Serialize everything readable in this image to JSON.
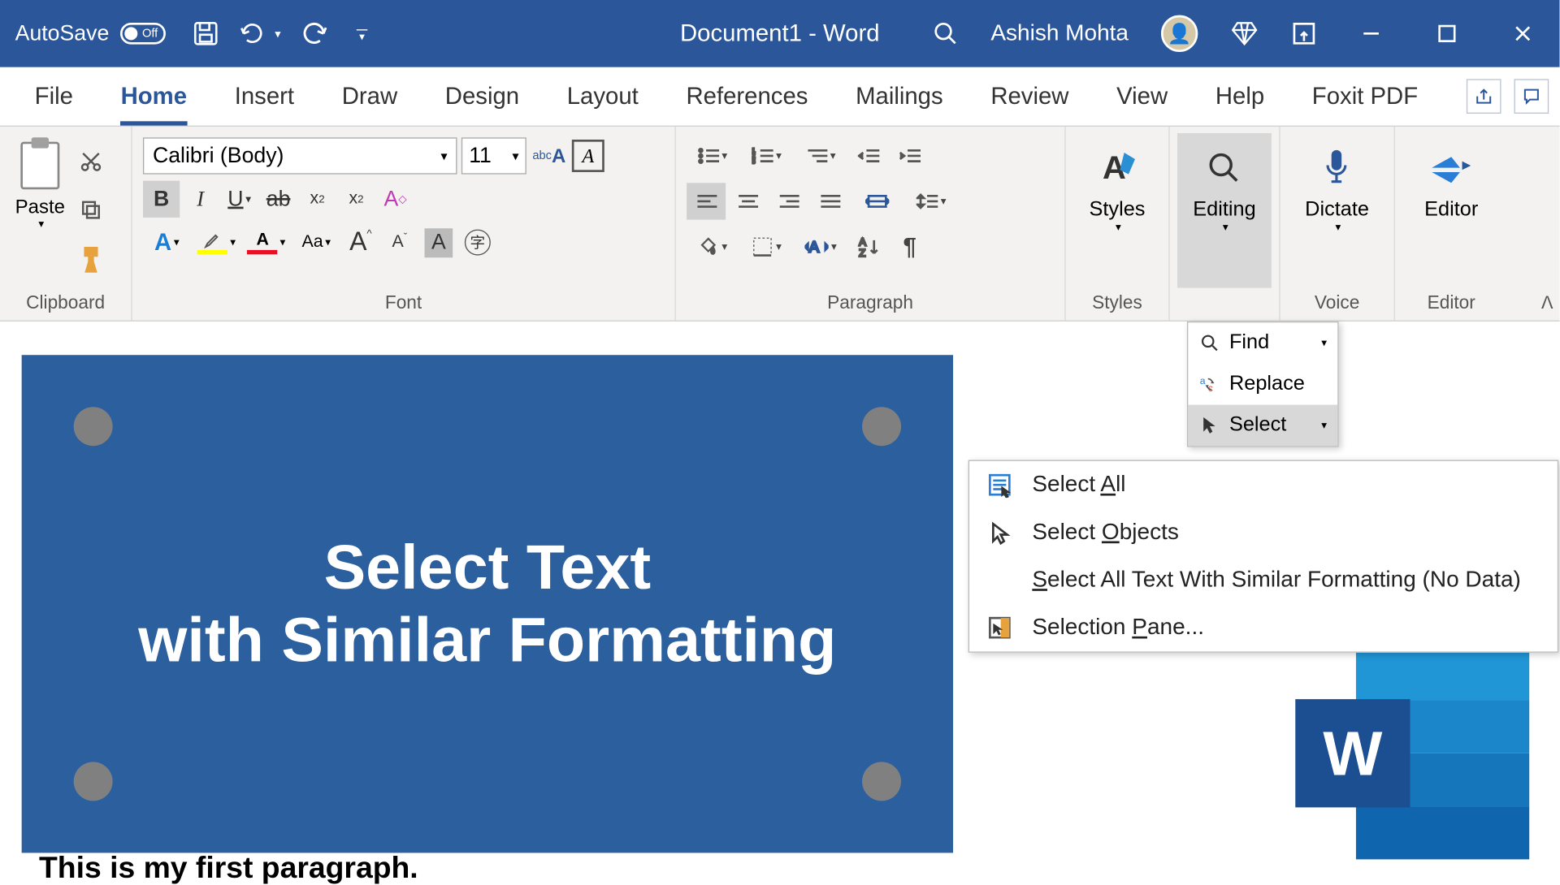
{
  "titlebar": {
    "autosave": "AutoSave",
    "toggle": "Off",
    "doc": "Document1  -  Word",
    "user": "Ashish Mohta"
  },
  "tabs": {
    "file": "File",
    "home": "Home",
    "insert": "Insert",
    "draw": "Draw",
    "design": "Design",
    "layout": "Layout",
    "references": "References",
    "mailings": "Mailings",
    "review": "Review",
    "view": "View",
    "help": "Help",
    "foxit": "Foxit PDF"
  },
  "ribbon": {
    "clipboard": {
      "paste": "Paste",
      "label": "Clipboard"
    },
    "font": {
      "name": "Calibri (Body)",
      "size": "11",
      "label": "Font",
      "bold": "B",
      "italic": "I",
      "underline": "U",
      "strike": "ab",
      "sub": "x",
      "sup": "x",
      "caseAa": "Aa",
      "bigA": "A",
      "smallA": "A",
      "shadeA": "A",
      "circleChar": "字"
    },
    "paragraph": {
      "label": "Paragraph"
    },
    "styles": {
      "btn": "Styles",
      "label": "Styles"
    },
    "editing": {
      "btn": "Editing"
    },
    "voice": {
      "btn": "Dictate",
      "label": "Voice"
    },
    "editor": {
      "btn": "Editor",
      "label": "Editor"
    }
  },
  "editingMenu": {
    "find": "Find",
    "replace": "Replace",
    "select": "Select"
  },
  "selectMenu": {
    "all_pre": "Select ",
    "all_u": "A",
    "all_post": "ll",
    "obj_pre": "Select ",
    "obj_u": "O",
    "obj_post": "bjects",
    "sim_u": "S",
    "sim_post": "elect All Text With Similar Formatting (No Data)",
    "pane_pre": "Selection ",
    "pane_u": "P",
    "pane_post": "ane..."
  },
  "doc": {
    "line1": "Select Text",
    "line2": "with Similar Formatting",
    "para": "This is my first paragraph."
  },
  "wordLogo": "W"
}
